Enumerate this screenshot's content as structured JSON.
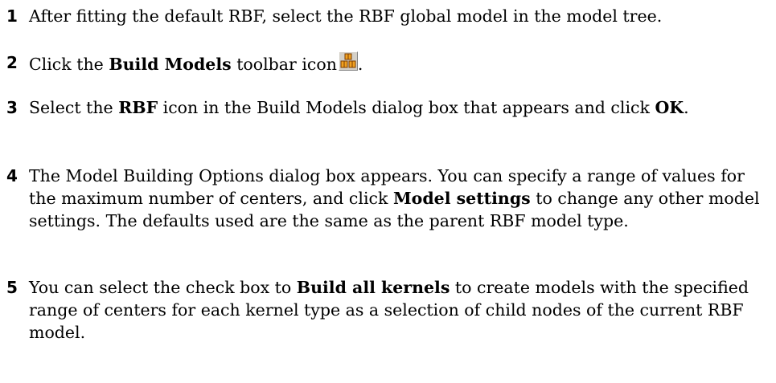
{
  "steps": [
    {
      "number": "1",
      "text": "After fitting the default RBF, select the RBF global model in the model tree."
    },
    {
      "number": "2",
      "pre": "Click the ",
      "bold": "Build Models",
      "post": " toolbar icon",
      "icon": "build-models-icon",
      "tail": "."
    },
    {
      "number": "3",
      "pre": "Select the ",
      "bold1": "RBF",
      "mid": " icon in the Build Models dialog box that appears and click ",
      "bold2": "OK",
      "post": "."
    },
    {
      "number": "4",
      "pre": "The Model Building Options dialog box appears. You can specify a range of values for the maximum number of centers, and click ",
      "bold": "Model settings",
      "post": " to change any other model settings. The defaults used are the same as the parent RBF model type."
    },
    {
      "number": "5",
      "pre": "You can select the check box to ",
      "bold": "Build all kernels",
      "post": " to create models with the specified range of centers for each kernel type as a selection of child nodes of the current RBF model."
    }
  ],
  "colors": {
    "text": "#000000",
    "background": "#ffffff",
    "icon_orange": "#f0a020",
    "icon_outline": "#7a3b00"
  }
}
